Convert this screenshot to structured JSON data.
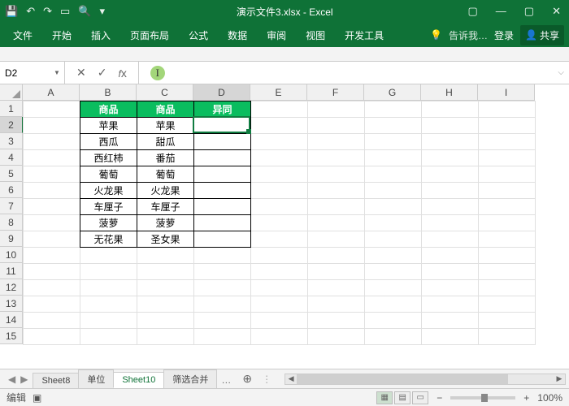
{
  "title": "演示文件3.xlsx - Excel",
  "ribbon": {
    "tabs": [
      "文件",
      "开始",
      "插入",
      "页面布局",
      "公式",
      "数据",
      "审阅",
      "视图",
      "开发工具"
    ],
    "tell": "告诉我…",
    "login": "登录",
    "share": "共享"
  },
  "formulaBar": {
    "nameBox": "D2",
    "value": ""
  },
  "columns": [
    "A",
    "B",
    "C",
    "D",
    "E",
    "F",
    "G",
    "H",
    "I"
  ],
  "rows": [
    "1",
    "2",
    "3",
    "4",
    "5",
    "6",
    "7",
    "8",
    "9",
    "10",
    "11",
    "12",
    "13",
    "14",
    "15"
  ],
  "active": {
    "col": "D",
    "row": "2"
  },
  "table": {
    "headers": [
      "商品",
      "商品",
      "异同"
    ],
    "rows": [
      [
        "苹果",
        "苹果",
        ""
      ],
      [
        "西瓜",
        "甜瓜",
        ""
      ],
      [
        "西红柿",
        "番茄",
        ""
      ],
      [
        "葡萄",
        "葡萄",
        ""
      ],
      [
        "火龙果",
        "火龙果",
        ""
      ],
      [
        "车厘子",
        "车厘子",
        ""
      ],
      [
        "菠萝",
        "菠萝",
        ""
      ],
      [
        "无花果",
        "圣女果",
        ""
      ]
    ]
  },
  "sheetTabs": {
    "tabs": [
      "Sheet8",
      "单位",
      "Sheet10",
      "筛选合并"
    ],
    "active": 2,
    "more": "…"
  },
  "status": {
    "mode": "编辑",
    "zoom": "100%"
  }
}
